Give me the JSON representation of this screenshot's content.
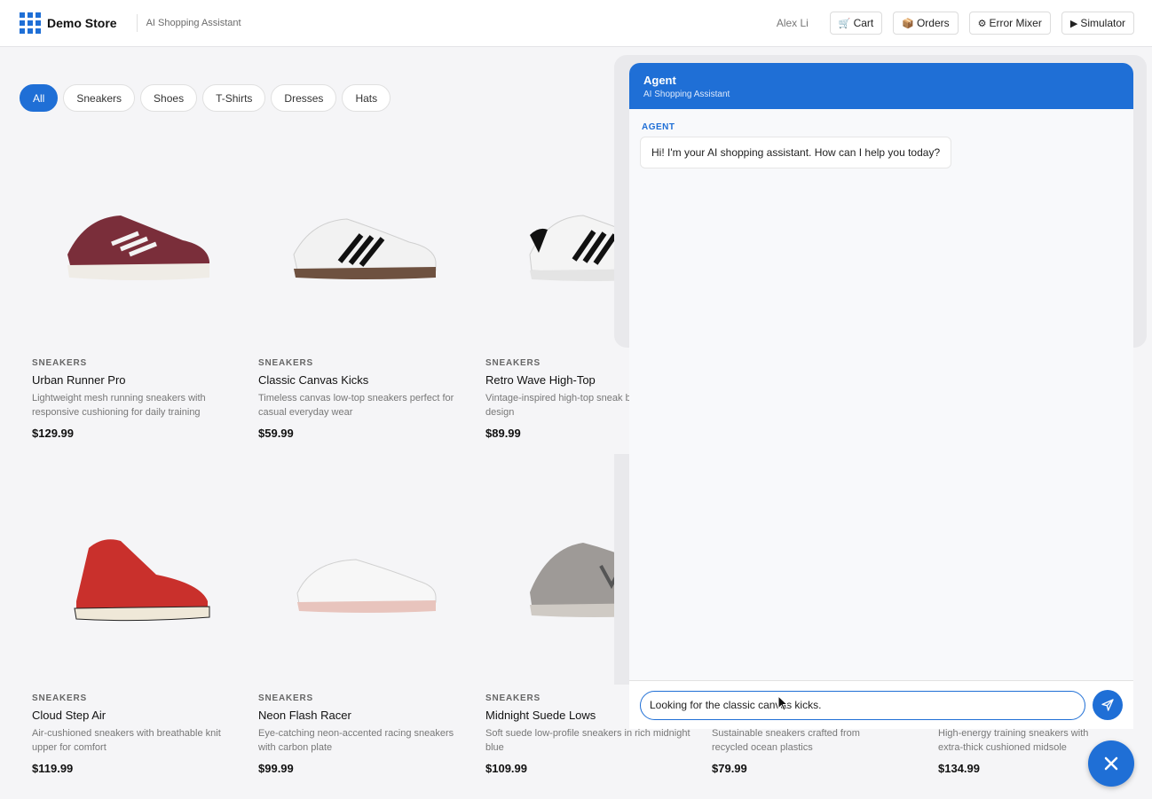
{
  "header": {
    "brand": "Demo Store",
    "subtitle": "AI Shopping Assistant",
    "user": "Alex Li",
    "buttons": [
      {
        "icon": "🛒",
        "label": "Cart"
      },
      {
        "icon": "📦",
        "label": "Orders"
      },
      {
        "icon": "⚙",
        "label": "Error Mixer"
      },
      {
        "icon": "▶",
        "label": "Simulator"
      }
    ]
  },
  "filters": {
    "active": "All",
    "items": [
      "All",
      "Sneakers",
      "Shoes",
      "T-Shirts",
      "Dresses",
      "Hats"
    ]
  },
  "products": [
    {
      "category": "SNEAKERS",
      "name": "Urban Runner Pro",
      "desc": "Lightweight mesh running sneakers with responsive cushioning for daily training",
      "price": "$129.99",
      "color": "#7a2e3a"
    },
    {
      "category": "SNEAKERS",
      "name": "Classic Canvas Kicks",
      "desc": "Timeless canvas low-top sneakers perfect for casual everyday wear",
      "price": "$59.99",
      "color": "#f2f2f2"
    },
    {
      "category": "SNEAKERS",
      "name": "Retro Wave High-Top",
      "desc": "Vintage-inspired high-top sneak bold colorblock design",
      "price": "$89.99",
      "color": "#f4f4f4"
    },
    {
      "category": "SNEAKERS",
      "name": "Cloud Step Air",
      "desc": "Air-cushioned sneakers with breathable knit upper for comfort",
      "price": "$119.99",
      "color": "#c9302c"
    },
    {
      "category": "SNEAKERS",
      "name": "Neon Flash Racer",
      "desc": "Eye-catching neon-accented racing sneakers with carbon plate",
      "price": "$99.99",
      "color": "#f7f7f7"
    },
    {
      "category": "SNEAKERS",
      "name": "Midnight Suede Lows",
      "desc": "Soft suede low-profile sneakers in rich midnight blue",
      "price": "$109.99",
      "color": "#9e9a97"
    },
    {
      "category": "",
      "name": "",
      "desc": "Sustainable sneakers crafted from recycled ocean plastics",
      "price": "$79.99",
      "color": "#ffffff"
    },
    {
      "category": "",
      "name": "",
      "desc": "High-energy training sneakers with extra-thick cushioned midsole",
      "price": "$134.99",
      "color": "#ffffff"
    }
  ],
  "chat": {
    "title": "Agent",
    "subtitle": "AI Shopping Assistant",
    "messages": [
      {
        "sender": "AGENT",
        "text": "Hi! I'm your AI shopping assistant. How can I help you today?"
      }
    ],
    "input_value": "Looking for the classic canvas kicks."
  },
  "colors": {
    "accent": "#1f6fd6"
  }
}
